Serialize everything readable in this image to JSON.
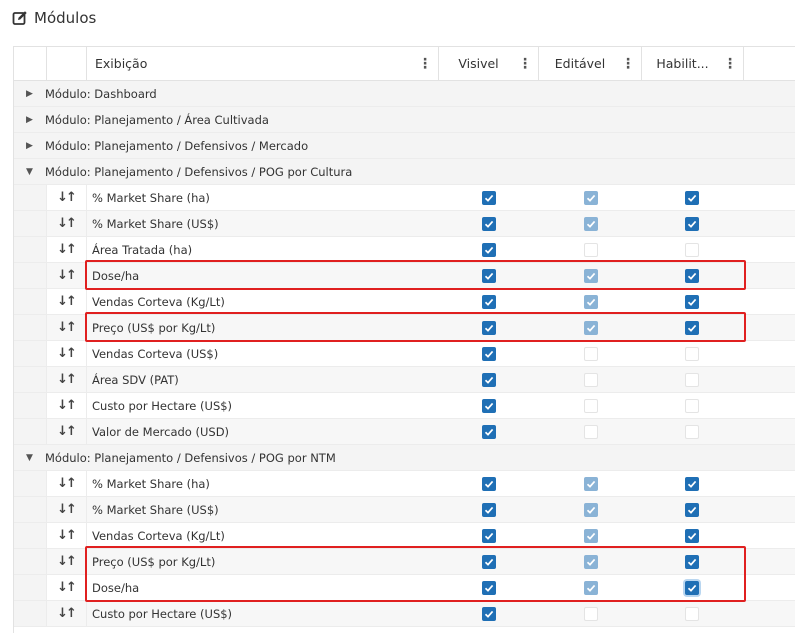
{
  "title": {
    "text": "Módulos",
    "icon": "edit-square-icon"
  },
  "columns": {
    "exibicao": "Exibição",
    "visivel": "Visivel",
    "editavel": "Editável",
    "habilitado": "Habilit..."
  },
  "groups": [
    {
      "label": "Módulo: Dashboard",
      "expanded": false
    },
    {
      "label": "Módulo: Planejamento / Área Cultivada",
      "expanded": false
    },
    {
      "label": "Módulo: Planejamento / Defensivos / Mercado",
      "expanded": false
    },
    {
      "label": "Módulo: Planejamento / Defensivos / POG por Cultura",
      "expanded": true,
      "rows": [
        {
          "name": "% Market Share (ha)",
          "visivel": "checked",
          "editavel": "checked-disabled",
          "habilitado": "checked"
        },
        {
          "name": "% Market Share (US$)",
          "visivel": "checked",
          "editavel": "checked-disabled",
          "habilitado": "checked"
        },
        {
          "name": "Área Tratada (ha)",
          "visivel": "checked",
          "editavel": "unchecked",
          "habilitado": "unchecked"
        },
        {
          "name": "Dose/ha",
          "visivel": "checked",
          "editavel": "checked-disabled",
          "habilitado": "checked",
          "highlighted": true
        },
        {
          "name": "Vendas Corteva (Kg/Lt)",
          "visivel": "checked",
          "editavel": "checked-disabled",
          "habilitado": "checked"
        },
        {
          "name": "Preço (US$ por Kg/Lt)",
          "visivel": "checked",
          "editavel": "checked-disabled",
          "habilitado": "checked",
          "highlighted": true
        },
        {
          "name": "Vendas Corteva (US$)",
          "visivel": "checked",
          "editavel": "unchecked",
          "habilitado": "unchecked"
        },
        {
          "name": "Área SDV (PAT)",
          "visivel": "checked",
          "editavel": "unchecked",
          "habilitado": "unchecked"
        },
        {
          "name": "Custo por Hectare (US$)",
          "visivel": "checked",
          "editavel": "unchecked",
          "habilitado": "unchecked"
        },
        {
          "name": "Valor de Mercado (USD)",
          "visivel": "checked",
          "editavel": "unchecked",
          "habilitado": "unchecked"
        }
      ]
    },
    {
      "label": "Módulo: Planejamento / Defensivos / POG por NTM",
      "expanded": true,
      "rows": [
        {
          "name": "% Market Share (ha)",
          "visivel": "checked",
          "editavel": "checked-disabled",
          "habilitado": "checked"
        },
        {
          "name": "% Market Share (US$)",
          "visivel": "checked",
          "editavel": "checked-disabled",
          "habilitado": "checked"
        },
        {
          "name": "Vendas Corteva (Kg/Lt)",
          "visivel": "checked",
          "editavel": "checked-disabled",
          "habilitado": "checked"
        },
        {
          "name": "Preço (US$ por Kg/Lt)",
          "visivel": "checked",
          "editavel": "checked-disabled",
          "habilitado": "checked",
          "highlighted": true
        },
        {
          "name": "Dose/ha",
          "visivel": "checked",
          "editavel": "checked-disabled",
          "habilitado": "checked-focused",
          "highlighted": true
        },
        {
          "name": "Custo por Hectare (US$)",
          "visivel": "checked",
          "editavel": "unchecked",
          "habilitado": "unchecked"
        }
      ]
    }
  ],
  "colors": {
    "checkbox": "#1f6fb5",
    "checkbox_disabled": "#8ab3d6",
    "highlight": "#e02020"
  }
}
